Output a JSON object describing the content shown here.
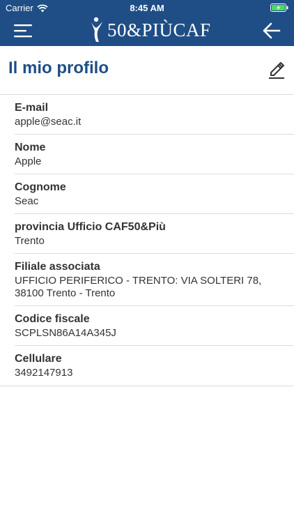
{
  "status_bar": {
    "carrier": "Carrier",
    "time": "8:45 AM"
  },
  "header": {
    "logo_text": "50&PIÙCAF",
    "icons": {
      "menu": "hamburger-menu-icon",
      "back": "arrow-left-icon",
      "logo_figure": "person-figure-icon"
    },
    "bar_color": "#1f4e86"
  },
  "page": {
    "title": "Il mio profilo",
    "edit_icon": "pencil-icon",
    "title_color": "#1f4e86"
  },
  "profile": {
    "fields": [
      {
        "label": "E-mail",
        "value": "apple@seac.it"
      },
      {
        "label": "Nome",
        "value": "Apple"
      },
      {
        "label": "Cognome",
        "value": "Seac"
      },
      {
        "label": "provincia Ufficio CAF50&Più",
        "value": "Trento"
      },
      {
        "label": "Filiale associata",
        "value": "UFFICIO PERIFERICO - TRENTO: VIA SOLTERI 78, 38100 Trento - Trento"
      },
      {
        "label": "Codice fiscale",
        "value": "SCPLSN86A14A345J"
      },
      {
        "label": "Cellulare",
        "value": "3492147913"
      }
    ]
  }
}
